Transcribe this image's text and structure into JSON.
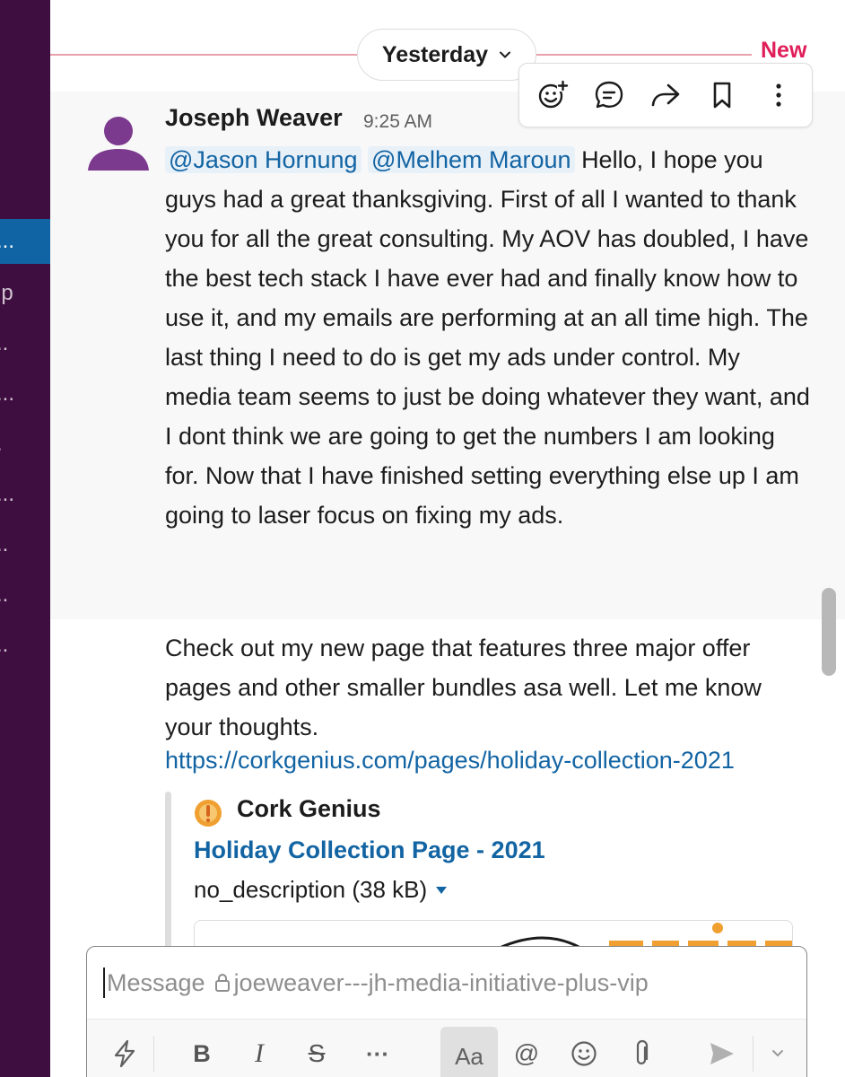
{
  "sidebar": {
    "items": [
      {
        "label": "...",
        "active": true
      },
      {
        "label": "ip",
        "active": false
      },
      {
        "label": "..",
        "active": false
      },
      {
        "label": "...",
        "active": false
      },
      {
        "label": ".",
        "active": false
      },
      {
        "label": "...",
        "active": false
      },
      {
        "label": "..",
        "active": false
      },
      {
        "label": "..",
        "active": false
      },
      {
        "label": "..",
        "active": false
      }
    ]
  },
  "divider": {
    "day_label": "Yesterday",
    "new_label": "New"
  },
  "message_actions": [
    {
      "icon": "add-reaction-icon"
    },
    {
      "icon": "reply-in-thread-icon"
    },
    {
      "icon": "share-message-icon"
    },
    {
      "icon": "bookmark-icon"
    },
    {
      "icon": "more-actions-icon"
    }
  ],
  "message": {
    "author": "Joseph Weaver",
    "time": "9:25 AM",
    "mentions": [
      "@Jason Hornung",
      "@Melhem Maroun"
    ],
    "text_1": "Hello, I hope you guys had a great thanksgiving.  First of all I wanted to thank you for all the great consulting.  My AOV has doubled, I have the best tech stack I have ever had and finally know how to use it,  and my emails are performing at an all time high.  The last thing I need to do is get my ads under control.  My media team seems to just be doing whatever they want, and I dont think we are going to get the numbers I am looking for.  Now that I have finished setting everything else up I am going to laser focus on fixing my ads.",
    "text_2": "Check out my new page that features three major offer pages and other smaller bundles asa well.  Let me know your thoughts.",
    "link": "https://corkgenius.com/pages/holiday-collection-2021",
    "unfurl": {
      "site_name": "Cork Genius",
      "title": "Holiday Collection Page - 2021",
      "file_desc": "no_description (38 kB)"
    }
  },
  "composer": {
    "placeholder": "Message",
    "channel": "joeweaver---jh-media-initiative-plus-vip",
    "toolbar": {
      "shortcuts_icon": "lightning-icon",
      "bold": "B",
      "italic": "I",
      "strike": "S",
      "more": "···",
      "format_toggle": "Aa",
      "mention": "@",
      "emoji_icon": "emoji-icon",
      "attach_icon": "paperclip-icon",
      "send_icon": "send-icon",
      "send_options_icon": "chevron-down-icon"
    }
  }
}
